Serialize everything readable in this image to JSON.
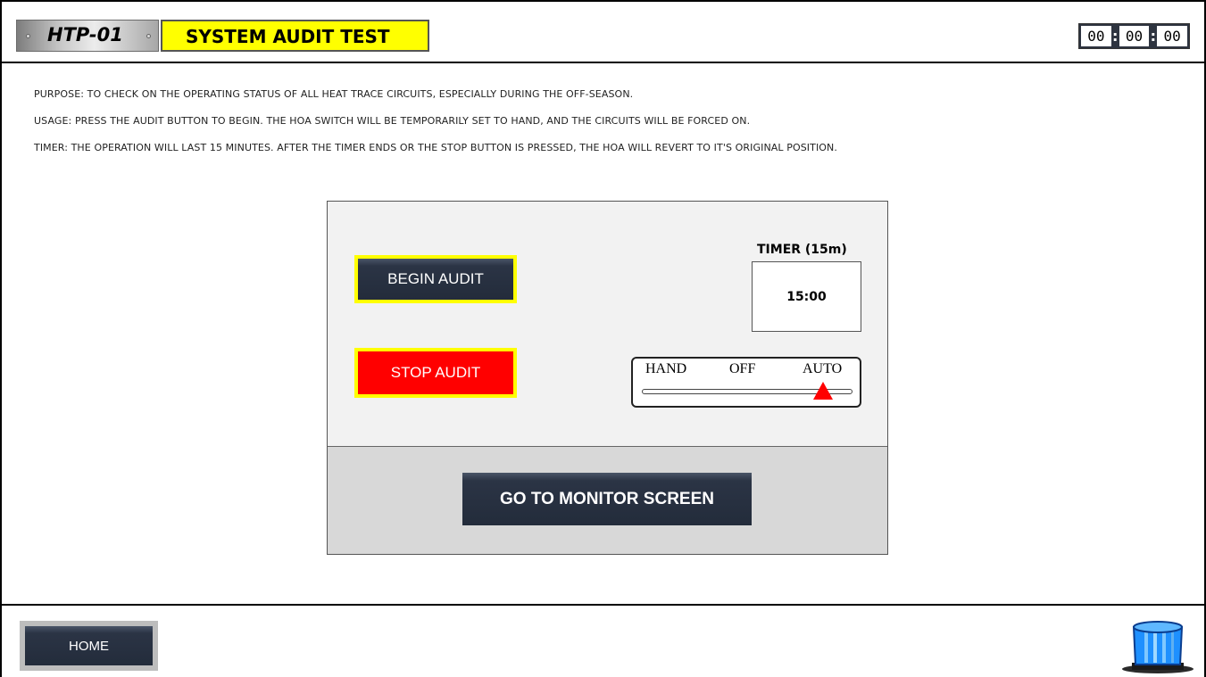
{
  "header": {
    "tag": "HTP-01",
    "title": "SYSTEM AUDIT TEST",
    "clock": [
      "00",
      "00",
      "00"
    ]
  },
  "description": {
    "purpose": "PURPOSE: TO CHECK ON THE OPERATING STATUS OF ALL HEAT TRACE CIRCUITS, ESPECIALLY DURING THE OFF-SEASON.",
    "usage": "USAGE: PRESS THE AUDIT BUTTON TO BEGIN. THE HOA SWITCH WILL BE TEMPORARILY SET TO HAND, AND THE CIRCUITS WILL BE FORCED ON.",
    "timer": "TIMER: THE OPERATION WILL LAST 15 MINUTES. AFTER THE TIMER ENDS OR THE STOP BUTTON IS PRESSED, THE HOA WILL REVERT TO IT'S ORIGINAL POSITION."
  },
  "panel": {
    "begin_label": "BEGIN AUDIT",
    "stop_label": "STOP AUDIT",
    "timer_label": "TIMER (15m)",
    "timer_value": "15:00",
    "hoa": {
      "hand": "HAND",
      "off": "OFF",
      "auto": "AUTO",
      "position": "AUTO"
    },
    "monitor_label": "GO TO MONITOR SCREEN"
  },
  "footer": {
    "home_label": "HOME",
    "beacon_icon": "blue-beacon-icon"
  },
  "colors": {
    "title_bg": "#ffff00",
    "stop_bg": "#ff0000",
    "button_dark": "#232c3b",
    "beacon": "#1e90ff"
  }
}
